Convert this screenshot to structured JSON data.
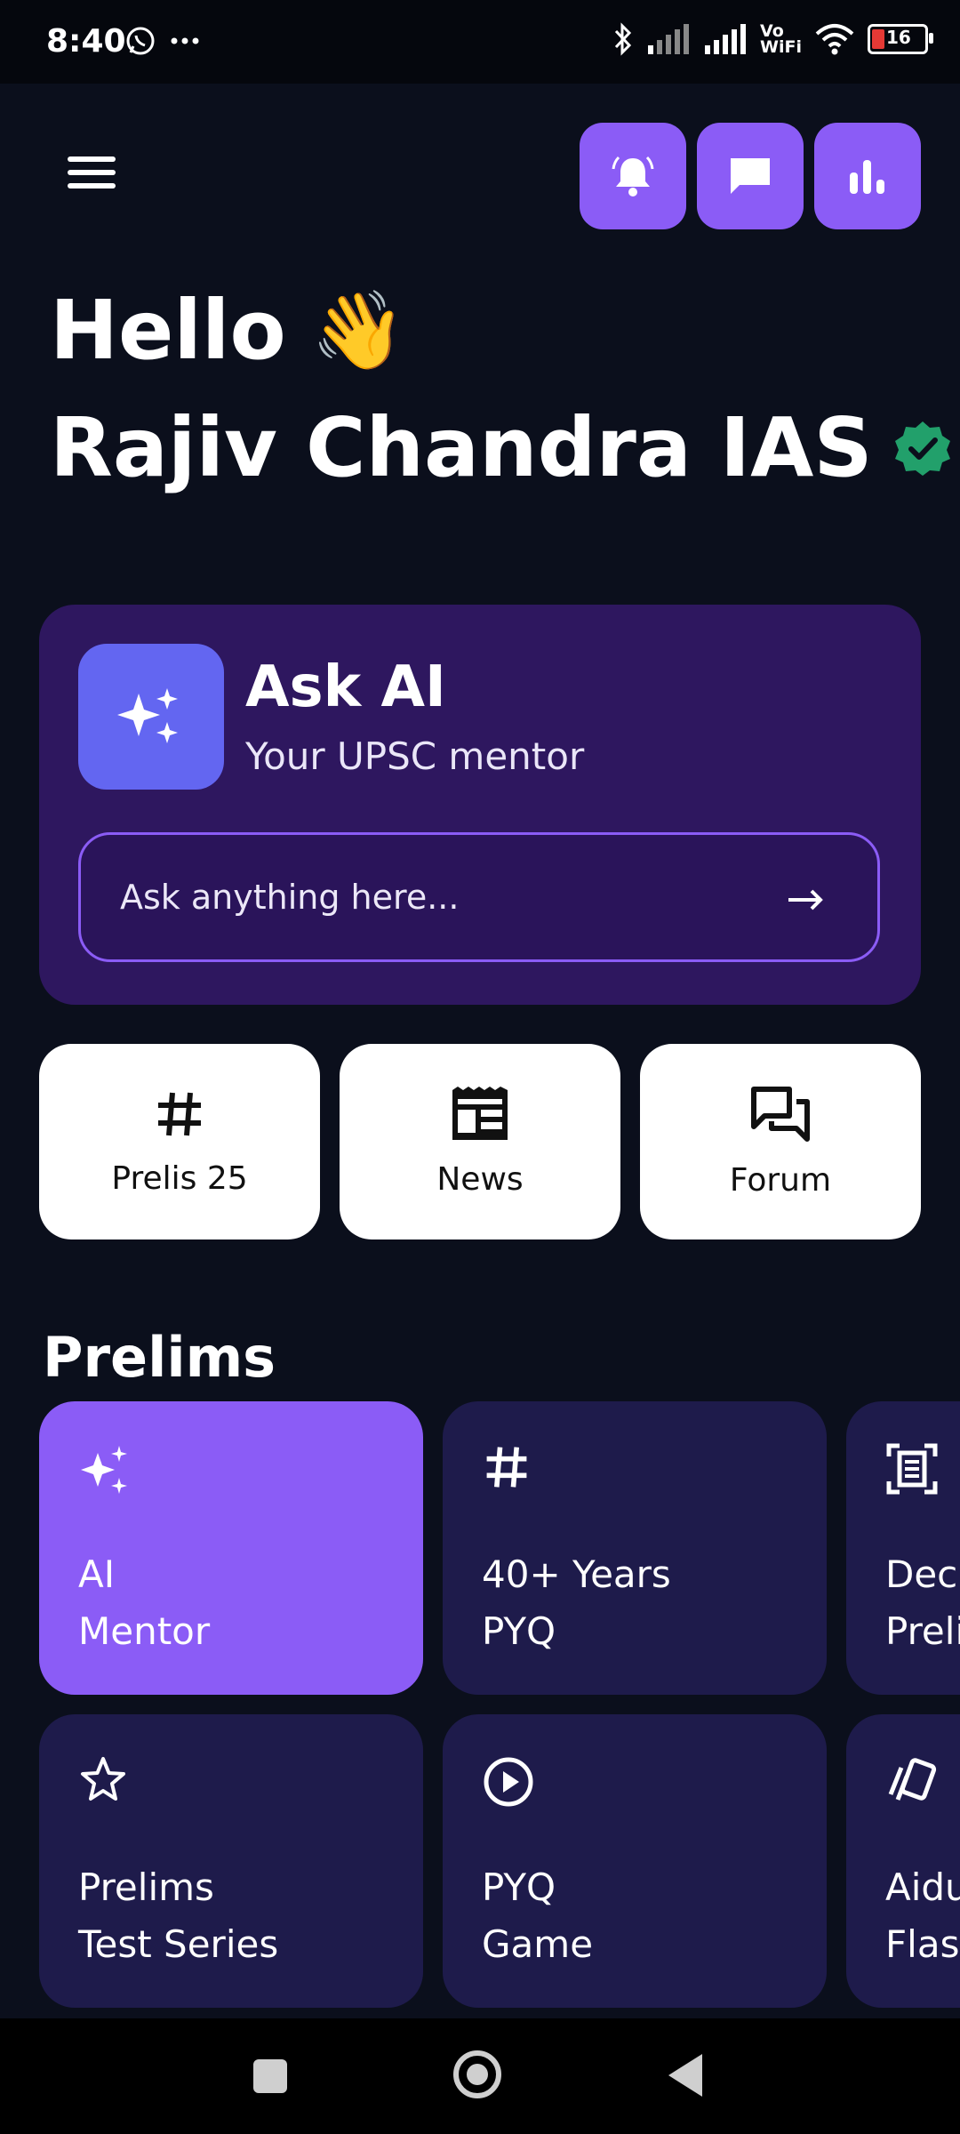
{
  "status_bar": {
    "time": "8:40",
    "battery": "16",
    "icons": [
      "whatsapp-icon",
      "more-dots-icon",
      "bluetooth-icon",
      "signal-icon",
      "signal-icon",
      "vowifi-icon",
      "wifi-icon",
      "battery-icon"
    ],
    "vowifi_top": "Vo",
    "vowifi_bottom": "WiFi"
  },
  "header": {
    "actions": [
      "bell-icon",
      "chat-icon",
      "stats-icon"
    ],
    "greeting": "Hello",
    "greeting_emoji": "👋",
    "user_name": "Rajiv Chandra IAS"
  },
  "ask_ai": {
    "title": "Ask AI",
    "subtitle": "Your UPSC mentor",
    "placeholder": "Ask anything here..."
  },
  "quick_links": [
    {
      "label": "Prelis 25",
      "icon": "hashtag-icon"
    },
    {
      "label": "News",
      "icon": "newspaper-icon"
    },
    {
      "label": "Forum",
      "icon": "forum-icon"
    }
  ],
  "section": {
    "title": "Prelims"
  },
  "cards": [
    {
      "line1": "AI",
      "line2": "Mentor",
      "icon": "sparkle-icon"
    },
    {
      "line1": "40+ Years",
      "line2": "PYQ",
      "icon": "hashtag-icon"
    },
    {
      "line1": "Dec",
      "line2": "Preli",
      "icon": "document-scan-icon"
    },
    {
      "line1": "Prelims",
      "line2": "Test Series",
      "icon": "star-icon"
    },
    {
      "line1": "PYQ",
      "line2": "Game",
      "icon": "play-circle-icon"
    },
    {
      "line1": "Aidu",
      "line2": "Flas",
      "icon": "cards-icon"
    }
  ],
  "colors": {
    "background": "#0b0f1c",
    "accent": "#8b5cf6",
    "card_dark": "#1e1b4b",
    "ask_ai_bg": "#2e175f",
    "verified": "#22a06b"
  }
}
